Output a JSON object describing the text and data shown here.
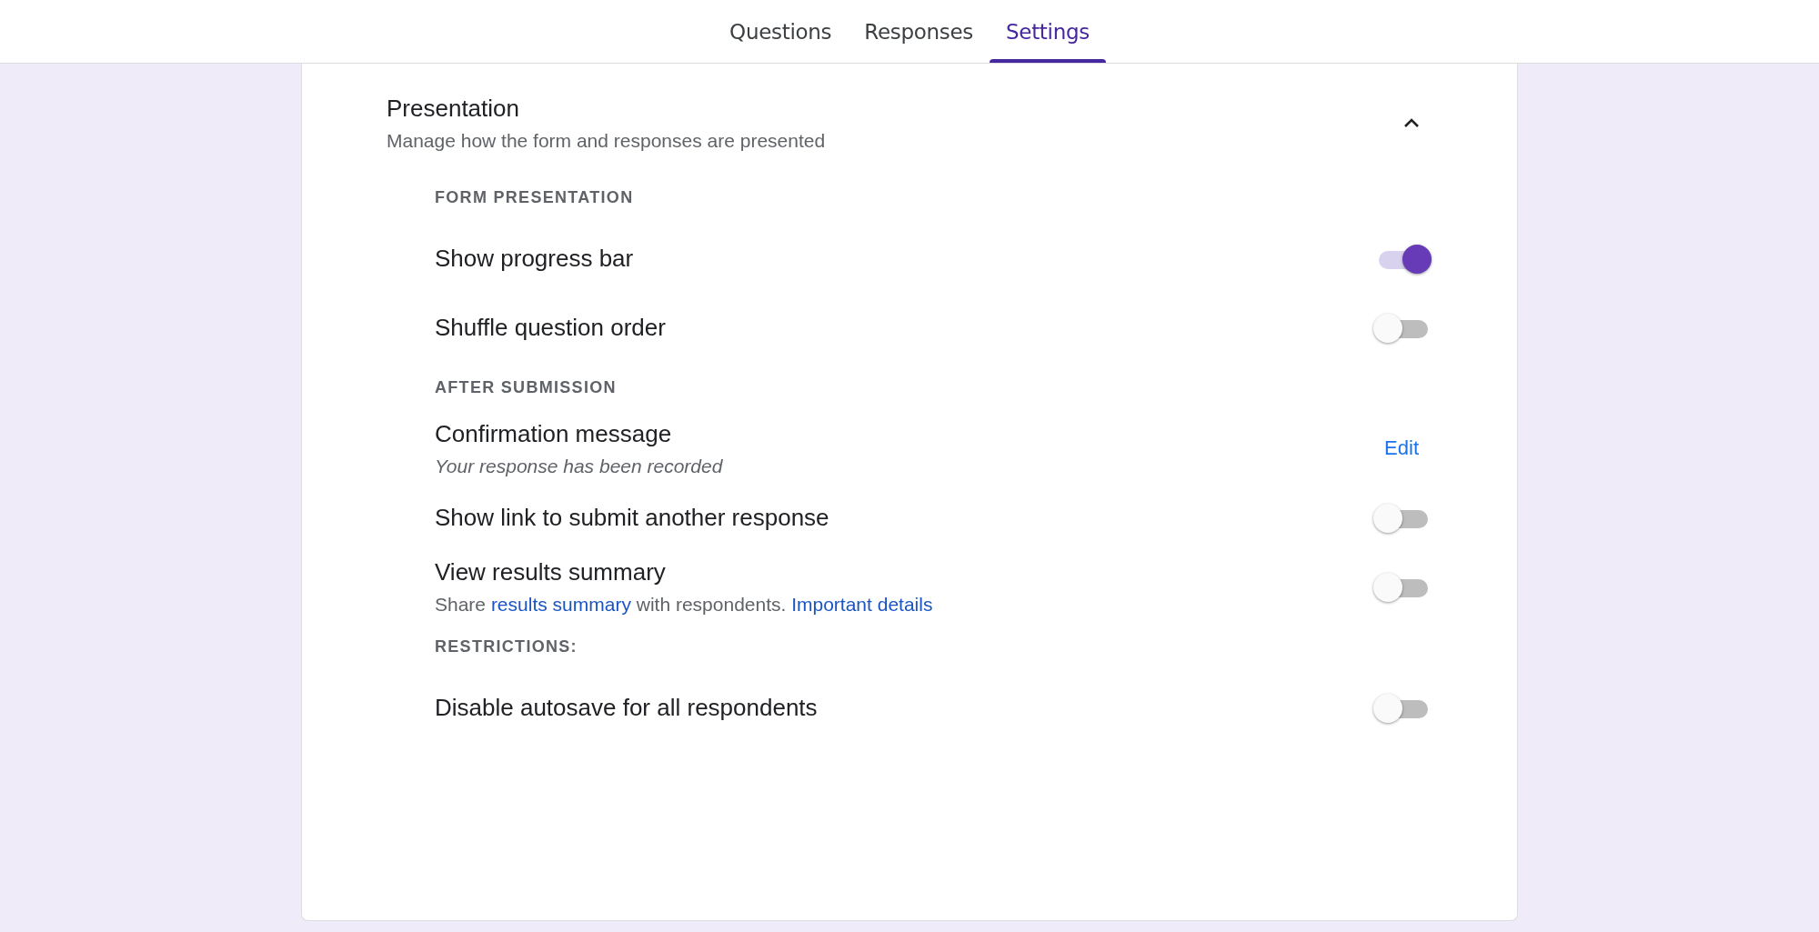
{
  "tabs": [
    {
      "label": "Questions",
      "selected": false
    },
    {
      "label": "Responses",
      "selected": false
    },
    {
      "label": "Settings",
      "selected": true
    }
  ],
  "section": {
    "title": "Presentation",
    "subtitle": "Manage how the form and responses are presented",
    "expanded": true,
    "groups": [
      {
        "heading": "FORM PRESENTATION",
        "items": [
          {
            "kind": "toggle",
            "label": "Show progress bar",
            "on": true
          },
          {
            "kind": "toggle",
            "label": "Shuffle question order",
            "on": false
          }
        ]
      },
      {
        "heading": "AFTER SUBMISSION",
        "items": [
          {
            "kind": "action",
            "label": "Confirmation message",
            "detail": "Your response has been recorded",
            "action": "Edit"
          },
          {
            "kind": "toggle",
            "label": "Show link to submit another response",
            "on": false
          },
          {
            "kind": "toggle",
            "label": "View results summary",
            "on": false,
            "description": [
              {
                "kind": "text",
                "text": "Share "
              },
              {
                "kind": "link",
                "text": "results summary"
              },
              {
                "kind": "text",
                "text": " with respondents. "
              },
              {
                "kind": "link",
                "text": "Important details"
              }
            ]
          }
        ]
      },
      {
        "heading": "RESTRICTIONS:",
        "items": [
          {
            "kind": "toggle",
            "label": "Disable autosave for all respondents",
            "on": false
          }
        ]
      }
    ]
  }
}
